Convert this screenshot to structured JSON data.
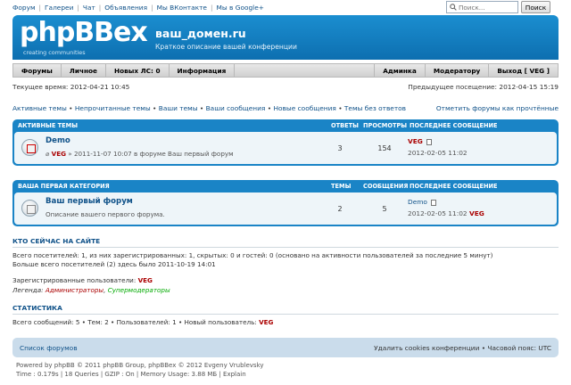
{
  "topnav": {
    "links": [
      "Форум",
      "Галереи",
      "Чат",
      "Объявления",
      "Мы ВКонтакте",
      "Мы в Google+"
    ],
    "search_placeholder": "Поиск...",
    "search_button": "Поиск"
  },
  "header": {
    "logo": "phpBBex",
    "logo_sub": "creating communities",
    "site_title": "ваш_домен.ru",
    "site_desc": "Краткое описание вашей конференции"
  },
  "menu": {
    "left": [
      "Форумы",
      "Личное",
      "Новых ЛС: 0",
      "Информация"
    ],
    "right": [
      "Админка",
      "Модератору",
      "Выход [ VEG ]"
    ]
  },
  "time": {
    "current": "Текущее время: 2012-04-21 10:45",
    "last_visit": "Предыдущее посещение: 2012-04-15 15:19"
  },
  "quicklinks": {
    "items": [
      "Активные темы",
      "Непрочитанные темы",
      "Ваши темы",
      "Ваши сообщения",
      "Новые сообщения",
      "Темы без ответов"
    ],
    "mark_read": "Отметить форумы как прочтённые"
  },
  "active_topics": {
    "heading": "АКТИВНЫЕ ТЕМЫ",
    "col_replies": "ОТВЕТЫ",
    "col_views": "ПРОСМОТРЫ",
    "col_last": "ПОСЛЕДНЕЕ СООБЩЕНИЕ",
    "row": {
      "title": "Demo",
      "author": "VEG",
      "meta": "» 2011-11-07 10:07 в форуме Ваш первый форум",
      "replies": "3",
      "views": "154",
      "last_author": "VEG",
      "last_date": "2012-02-05 11:02"
    }
  },
  "category": {
    "heading": "ВАША ПЕРВАЯ КАТЕГОРИЯ",
    "col_topics": "ТЕМЫ",
    "col_posts": "СООБЩЕНИЯ",
    "col_last": "ПОСЛЕДНЕЕ СООБЩЕНИЕ",
    "row": {
      "title": "Ваш первый форум",
      "desc": "Описание вашего первого форума.",
      "topics": "2",
      "posts": "5",
      "last_title": "Demo",
      "last_date": "2012-02-05 11:02",
      "last_author": "VEG"
    }
  },
  "online": {
    "heading": "КТО СЕЙЧАС НА САЙТЕ",
    "line1": "Всего посетителей: 1, из них зарегистрированных: 1, скрытых: 0 и гостей: 0 (основано на активности пользователей за последние 5 минут)",
    "line2": "Больше всего посетителей (2) здесь было 2011-10-19 14:01",
    "registered_label": "Зарегистрированные пользователи:",
    "registered_user": "VEG",
    "legend_label": "Легенда:",
    "legend_admins": "Администраторы",
    "legend_mods": "Супермодераторы"
  },
  "stats": {
    "heading": "СТАТИСТИКА",
    "line": "Всего сообщений: 5 • Тем: 2 • Пользователей: 1 • Новый пользователь:",
    "new_user": "VEG"
  },
  "footer": {
    "left": "Список форумов",
    "right": "Удалить cookies конференции • Часовой пояс: UTC",
    "copy1": "Powered by phpBB © 2011 phpBB Group, phpBBex © 2012 Evgeny Vrublevsky",
    "copy2": "Time : 0.179s | 18 Queries | GZIP : On | Memory Usage: 3.88 МБ | Explain"
  },
  "colors": {
    "header_blue": "#1b8ed0",
    "panel_blue": "#1a84c6",
    "link": "#105289",
    "admin_red": "#aa0000",
    "mod_green": "#00aa00"
  }
}
